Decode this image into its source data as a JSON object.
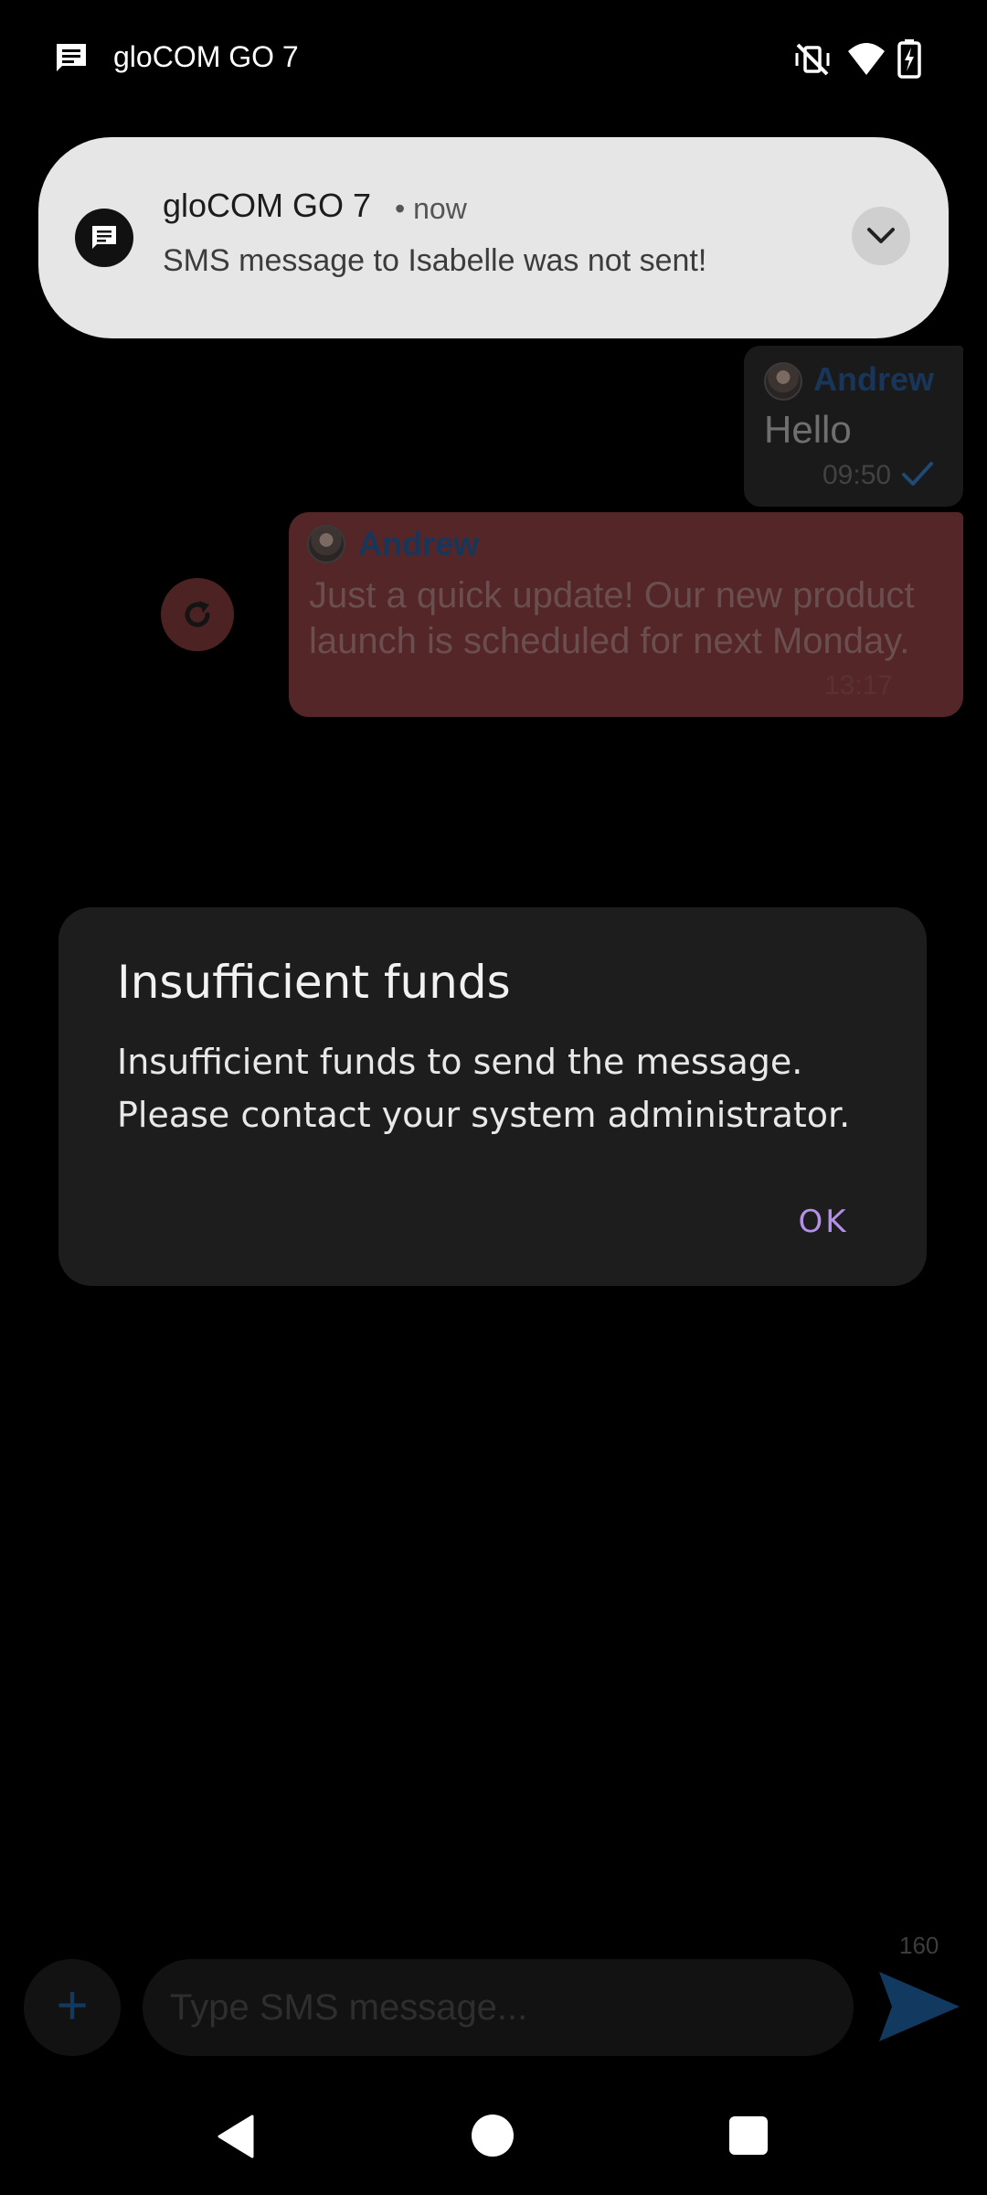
{
  "status_bar": {
    "app_title": "gloCOM GO 7",
    "icons": [
      "message-icon",
      "vibrate-off-icon",
      "wifi-icon",
      "battery-charging-icon"
    ]
  },
  "notification": {
    "app_name": "gloCOM GO 7",
    "time": "• now",
    "body": "SMS message to Isabelle was not sent!",
    "icon": "message-icon",
    "expand_icon": "chevron-down-icon"
  },
  "chat": {
    "messages": [
      {
        "sender": "Andrew",
        "text": "Hello",
        "time": "09:50",
        "status_icon": "check-icon"
      },
      {
        "sender": "Andrew",
        "text": "Just a quick update! Our new product launch is scheduled for next Monday.",
        "time": "13:17",
        "status": "failed"
      }
    ],
    "retry_icon": "refresh-icon"
  },
  "composer": {
    "char_count": "160",
    "placeholder": "Type SMS message...",
    "add_label": "+",
    "send_icon": "send-icon"
  },
  "dialog": {
    "title": "Insufficient funds",
    "message": "Insufficient funds to send the message. Please contact your system administrator.",
    "ok_label": "OK"
  },
  "colors": {
    "accent": "#b490e8",
    "sender_name": "#17365a",
    "failed_bubble": "#552628",
    "dialog_bg": "#1d1d1d"
  }
}
